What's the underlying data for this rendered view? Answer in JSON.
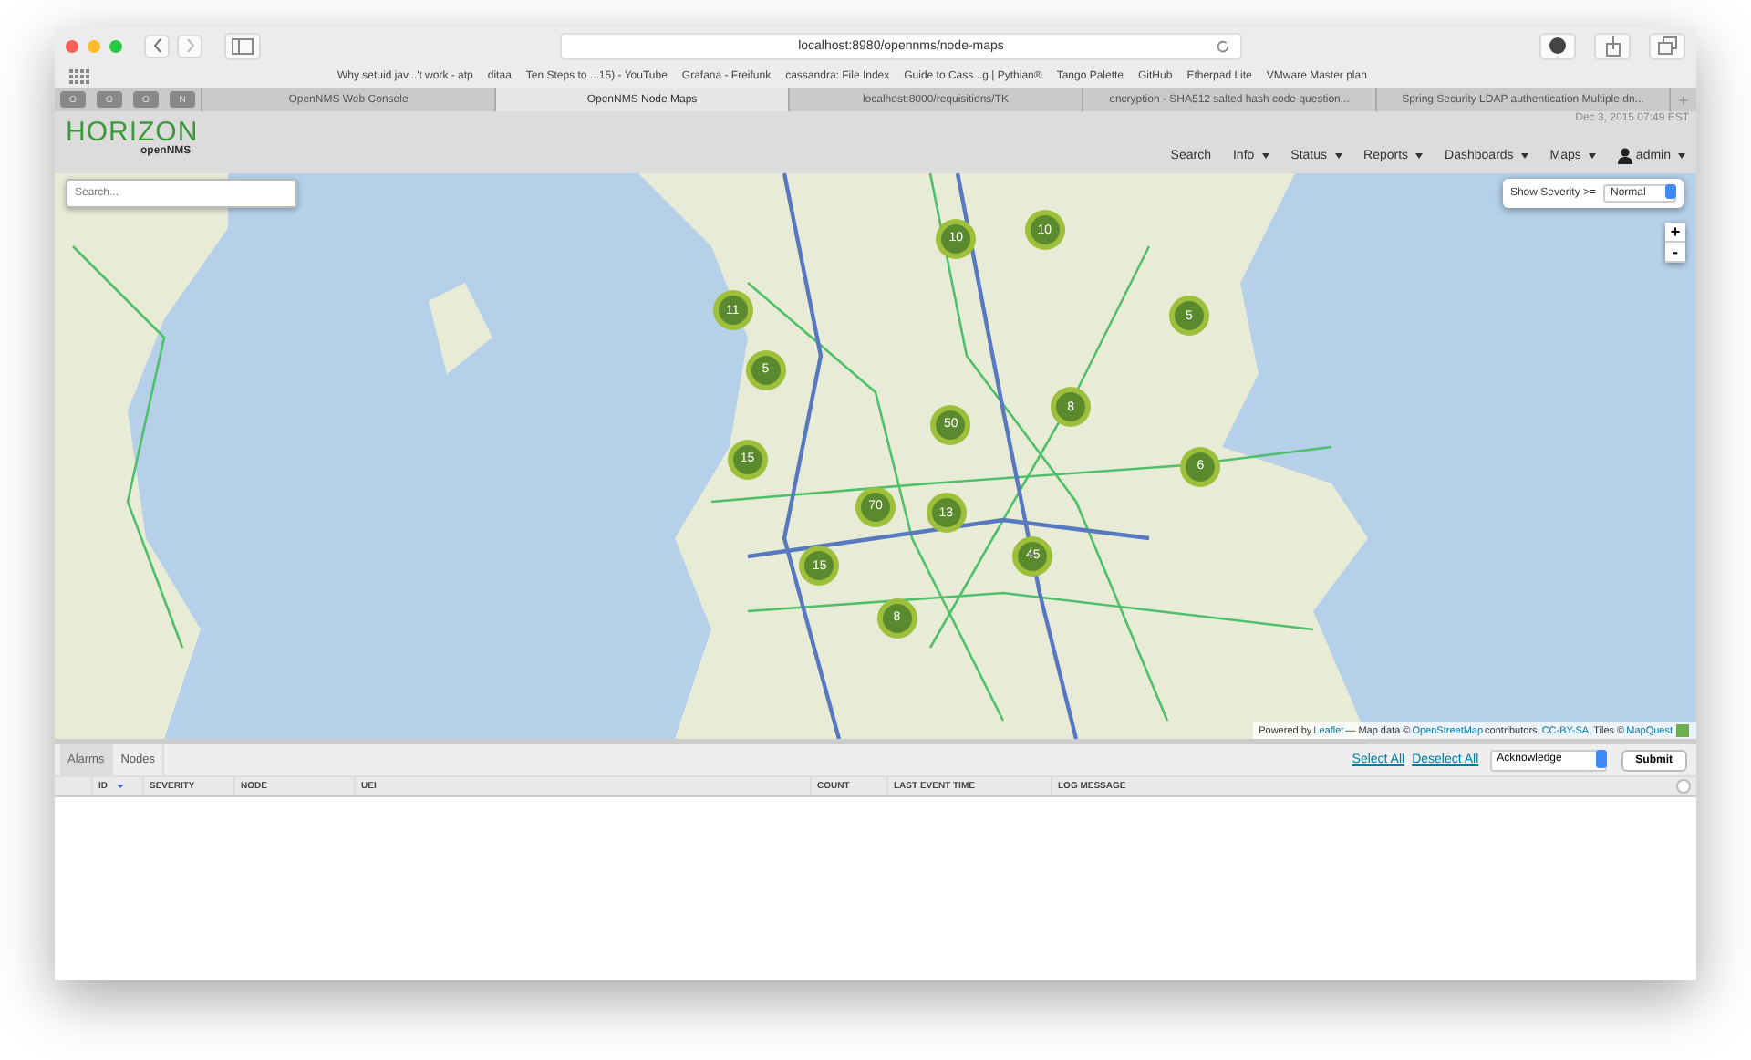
{
  "browser": {
    "url": "localhost:8980/opennms/node-maps",
    "bookmarks": [
      "Why setuid jav...'t work - atp",
      "ditaa",
      "Ten Steps to ...15) - YouTube",
      "Grafana - Freifunk",
      "cassandra: File Index",
      "Guide to Cass...g | Pythian®",
      "Tango Palette",
      "GitHub",
      "Etherpad Lite",
      "VMware Master plan"
    ],
    "pinned_tabs": [
      "O",
      "O",
      "O",
      "N"
    ],
    "tabs": [
      {
        "label": "OpenNMS Web Console",
        "selected": false
      },
      {
        "label": "OpenNMS Node Maps",
        "selected": true
      },
      {
        "label": "localhost:8000/requisitions/TK",
        "selected": false
      },
      {
        "label": "encryption - SHA512 salted hash code question...",
        "selected": false
      },
      {
        "label": "Spring Security LDAP authentication Multiple dn...",
        "selected": false
      }
    ],
    "new_tab": "+"
  },
  "header": {
    "logo": "HORIZON",
    "logo_sub": "openNMS",
    "datetime": "Dec 3, 2015 07:49 EST",
    "nav": [
      {
        "label": "Search",
        "dropdown": false
      },
      {
        "label": "Info",
        "dropdown": true
      },
      {
        "label": "Status",
        "dropdown": true
      },
      {
        "label": "Reports",
        "dropdown": true
      },
      {
        "label": "Dashboards",
        "dropdown": true
      },
      {
        "label": "Maps",
        "dropdown": true
      },
      {
        "label": "admin",
        "dropdown": true
      }
    ]
  },
  "map": {
    "search_placeholder": "Search...",
    "severity_label": "Show Severity >=",
    "severity_value": "Normal",
    "zoom_in": "+",
    "zoom_out": "-",
    "clusters": [
      "10",
      "10",
      "11",
      "5",
      "5",
      "8",
      "50",
      "15",
      "6",
      "70",
      "13",
      "45",
      "15",
      "8"
    ],
    "attribution": [
      {
        "kind": "text",
        "text": "Powered by"
      },
      {
        "kind": "link",
        "text": "Leaflet"
      },
      {
        "kind": "text",
        "text": "— Map data ©"
      },
      {
        "kind": "link",
        "text": "OpenStreetMap"
      },
      {
        "kind": "text",
        "text": "contributors,"
      },
      {
        "kind": "link",
        "text": "CC-BY-SA,"
      },
      {
        "kind": "text",
        "text": "Tiles ©"
      },
      {
        "kind": "link",
        "text": "MapQuest"
      }
    ]
  },
  "panel": {
    "tabs": [
      {
        "label": "Alarms",
        "selected": true
      },
      {
        "label": "Nodes",
        "selected": false
      }
    ],
    "select_all": "Select All",
    "deselect_all": "Deselect All",
    "action": "Acknowledge",
    "submit": "Submit",
    "columns": [
      "ID",
      "SEVERITY",
      "NODE",
      "UEI",
      "COUNT",
      "LAST EVENT TIME",
      "LOG MESSAGE"
    ]
  }
}
